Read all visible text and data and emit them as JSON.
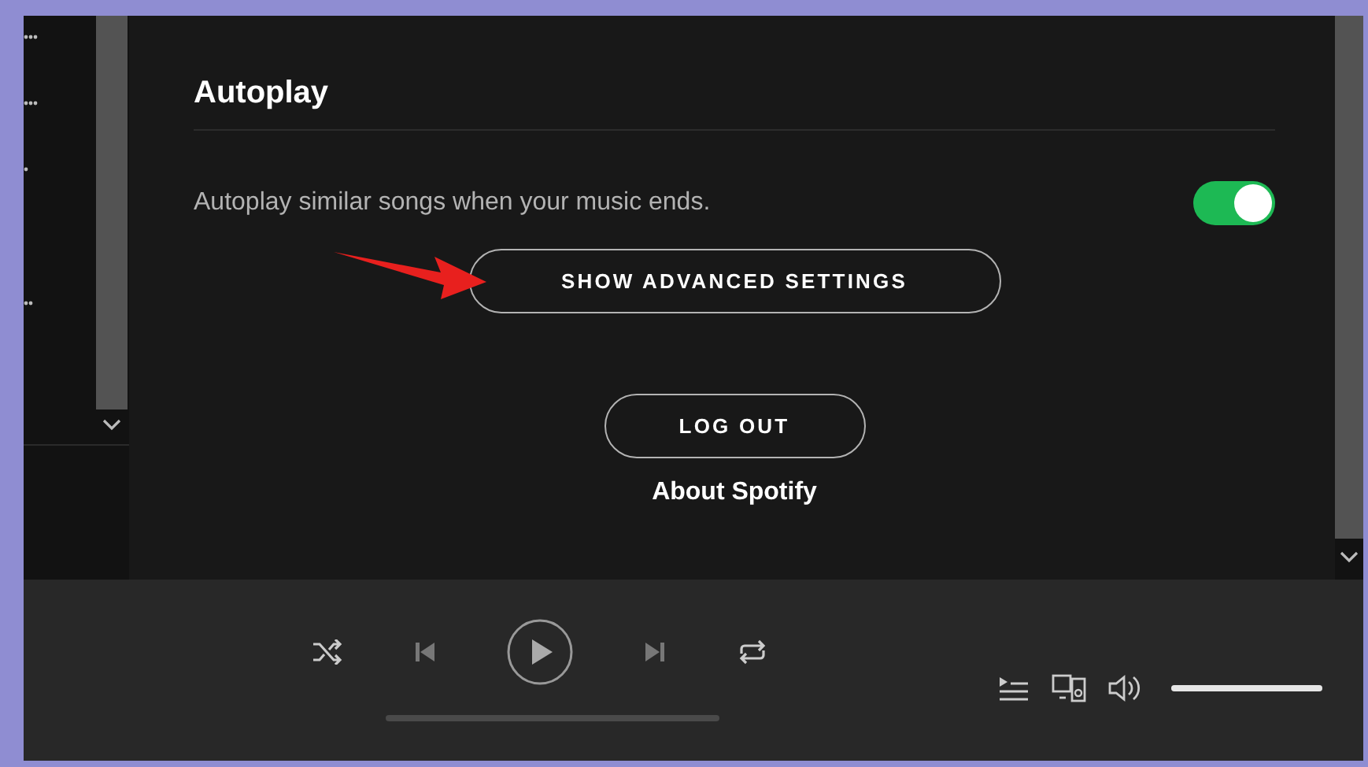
{
  "settings": {
    "section_title": "Autoplay",
    "autoplay": {
      "label": "Autoplay similar songs when your music ends.",
      "on": true
    },
    "advanced_button": "SHOW ADVANCED SETTINGS",
    "logout_button": "LOG OUT",
    "about_link": "About Spotify"
  },
  "player": {
    "volume": {
      "level": 1
    }
  }
}
